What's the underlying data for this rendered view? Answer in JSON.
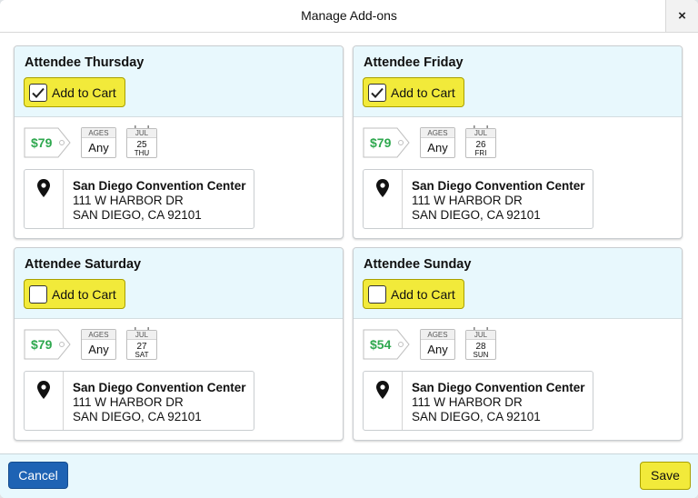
{
  "dialog": {
    "title": "Manage Add-ons",
    "close_label": "×"
  },
  "cards": [
    {
      "title": "Attendee Thursday",
      "cart_label": "Add to Cart",
      "checked": true,
      "price": "$79",
      "ages_label": "AGES",
      "ages_value": "Any",
      "month": "JUL",
      "day": "25",
      "dow": "THU",
      "venue_name": "San Diego Convention Center",
      "venue_street": "111 W HARBOR DR",
      "venue_city": "SAN DIEGO, CA 92101"
    },
    {
      "title": "Attendee Friday",
      "cart_label": "Add to Cart",
      "checked": true,
      "price": "$79",
      "ages_label": "AGES",
      "ages_value": "Any",
      "month": "JUL",
      "day": "26",
      "dow": "FRI",
      "venue_name": "San Diego Convention Center",
      "venue_street": "111 W HARBOR DR",
      "venue_city": "SAN DIEGO, CA 92101"
    },
    {
      "title": "Attendee Saturday",
      "cart_label": "Add to Cart",
      "checked": false,
      "price": "$79",
      "ages_label": "AGES",
      "ages_value": "Any",
      "month": "JUL",
      "day": "27",
      "dow": "SAT",
      "venue_name": "San Diego Convention Center",
      "venue_street": "111 W HARBOR DR",
      "venue_city": "SAN DIEGO, CA 92101"
    },
    {
      "title": "Attendee Sunday",
      "cart_label": "Add to Cart",
      "checked": false,
      "price": "$54",
      "ages_label": "AGES",
      "ages_value": "Any",
      "month": "JUL",
      "day": "28",
      "dow": "SUN",
      "venue_name": "San Diego Convention Center",
      "venue_street": "111 W HARBOR DR",
      "venue_city": "SAN DIEGO, CA 92101"
    }
  ],
  "footer": {
    "cancel_label": "Cancel",
    "save_label": "Save"
  },
  "colors": {
    "accent_yellow": "#f2ea3a",
    "cancel_blue": "#1e63b4",
    "price_green": "#2fa84f",
    "header_tint": "#e8f8fd"
  },
  "icons": {
    "close": "close-icon",
    "check": "check-icon",
    "tag": "price-tag-icon",
    "calendar": "calendar-icon",
    "location": "map-pin-icon"
  }
}
